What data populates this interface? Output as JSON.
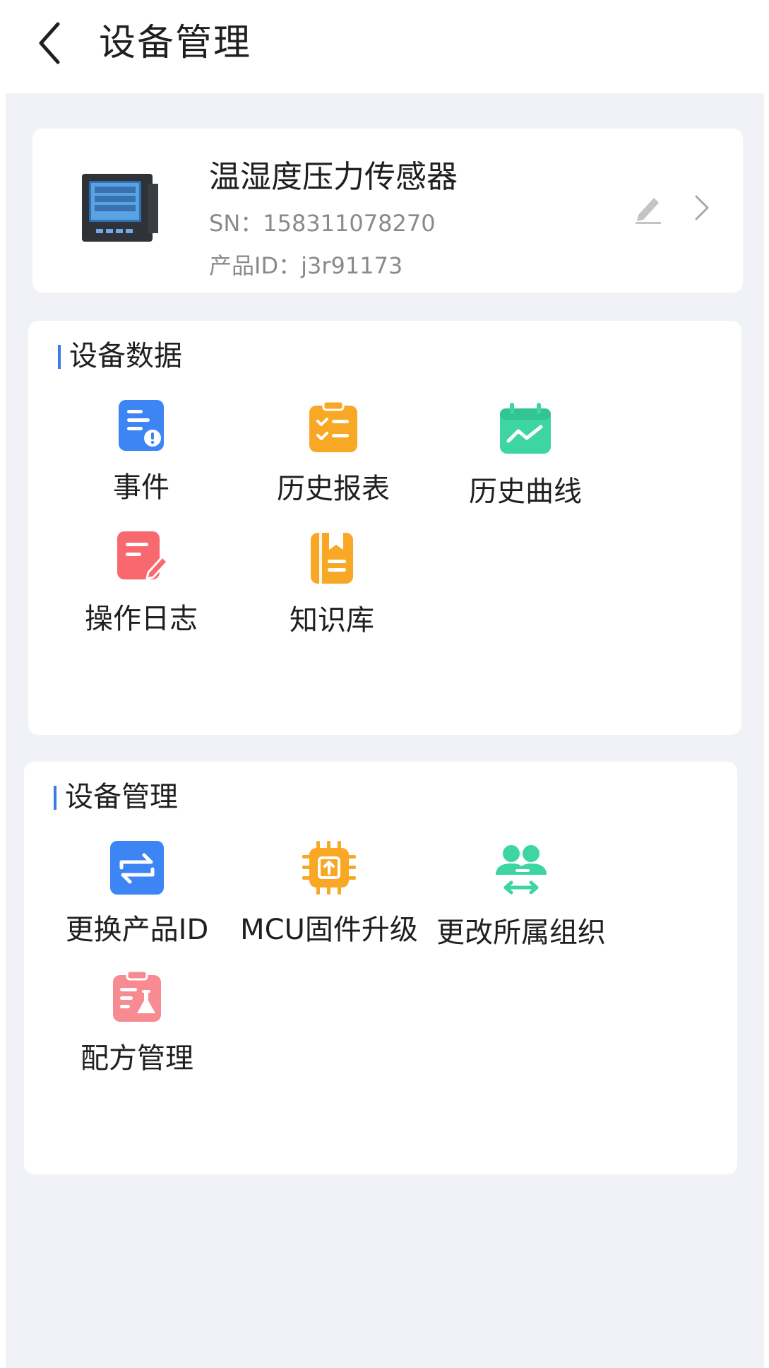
{
  "header": {
    "title": "设备管理"
  },
  "device": {
    "name": "温湿度压力传感器",
    "sn": "SN：158311078270",
    "product_id": "产品ID：j3r91173"
  },
  "sections": {
    "data": {
      "title": "设备数据",
      "items": [
        {
          "label": "事件",
          "icon": "event-icon",
          "color": "#3d84f5"
        },
        {
          "label": "历史报表",
          "icon": "history-report-icon",
          "color": "#f9a825"
        },
        {
          "label": "历史曲线",
          "icon": "history-curve-icon",
          "color": "#3dd6a2"
        },
        {
          "label": "操作日志",
          "icon": "operation-log-icon",
          "color": "#f8686f"
        },
        {
          "label": "知识库",
          "icon": "knowledge-base-icon",
          "color": "#f9a825"
        }
      ]
    },
    "management": {
      "title": "设备管理",
      "items": [
        {
          "label": "更换产品ID",
          "icon": "swap-icon",
          "color": "#3d84f5"
        },
        {
          "label": "MCU固件升级",
          "icon": "chip-upgrade-icon",
          "color": "#f9a825"
        },
        {
          "label": "更改所属组织",
          "icon": "change-organization-icon",
          "color": "#3dd6a2"
        },
        {
          "label": "配方管理",
          "icon": "recipe-icon",
          "color": "#f88a92"
        }
      ]
    }
  }
}
